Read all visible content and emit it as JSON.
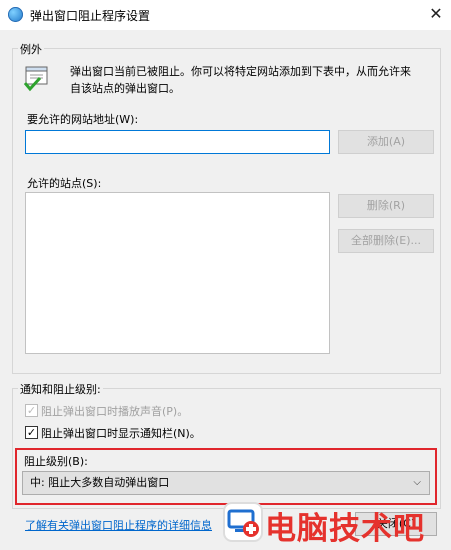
{
  "window": {
    "title": "弹出窗口阻止程序设置",
    "close_glyph": "✕"
  },
  "exceptions": {
    "group_label": "例外",
    "info_text": "弹出窗口当前已被阻止。你可以将特定网站添加到下表中，从而允许来自该站点的弹出窗口。",
    "address_label": "要允许的网站地址(W):",
    "address_value": "",
    "add_button": "添加(A)",
    "allowed_label": "允许的站点(S):",
    "allowed_sites": [],
    "remove_button": "删除(R)",
    "remove_all_button": "全部删除(E)..."
  },
  "notify": {
    "group_label": "通知和阻止级别:",
    "sound_label": "阻止弹出窗口时播放声音(P)。",
    "sound_checked": true,
    "sound_disabled": true,
    "bar_label": "阻止弹出窗口时显示通知栏(N)。",
    "bar_checked": true,
    "level_label": "阻止级别(B):",
    "level_value": "中: 阻止大多数自动弹出窗口"
  },
  "footer": {
    "learn_more_link": "了解有关弹出窗口阻止程序的详细信息",
    "close_button": "关闭(C)"
  },
  "watermark": {
    "text": "电脑技术吧"
  },
  "colors": {
    "accent": "#0078d7",
    "highlight_red": "#e0262c",
    "link": "#0066cc",
    "watermark": "#e5322d"
  }
}
